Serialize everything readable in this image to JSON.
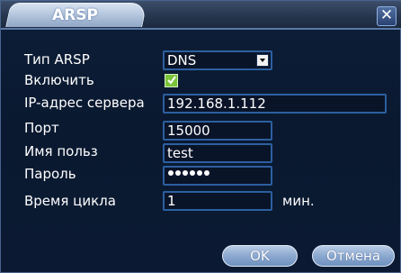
{
  "dialog": {
    "title": "ARSP",
    "close_glyph": "✕"
  },
  "form": {
    "arsp_type": {
      "label": "Тип ARSP",
      "value": "DNS"
    },
    "enable": {
      "label": "Включить",
      "checked": true
    },
    "server_ip": {
      "label": "IP-адрес сервера",
      "value": "192.168.1.112"
    },
    "port": {
      "label": "Порт",
      "value": "15000"
    },
    "username": {
      "label": "Имя польз",
      "value": "test"
    },
    "password": {
      "label": "Пароль",
      "value_masked_length": 6
    },
    "cycle_time": {
      "label": "Время цикла",
      "value": "1",
      "unit": "мин."
    }
  },
  "buttons": {
    "ok_label": "OK",
    "cancel_label": "Отмена"
  }
}
